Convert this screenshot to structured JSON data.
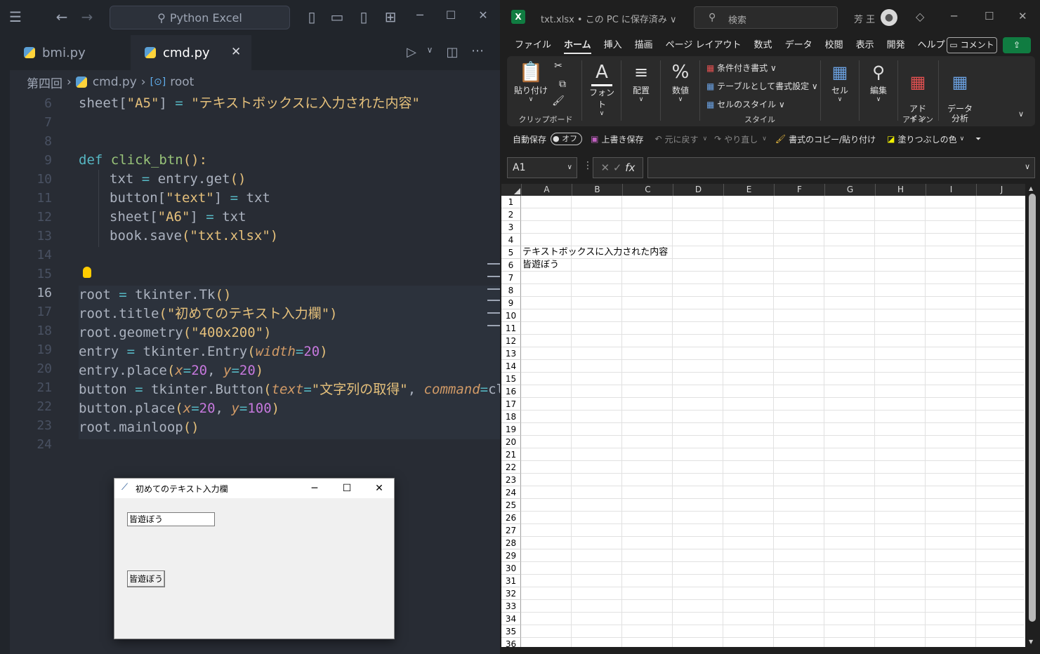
{
  "vscode": {
    "search_text": "Python Excel",
    "tabs": [
      {
        "label": "bmi.py",
        "active": false
      },
      {
        "label": "cmd.py",
        "active": true
      }
    ],
    "close_glyph": "✕",
    "breadcrumb": {
      "folder": "第四回",
      "file": "cmd.py",
      "symbol": "root"
    },
    "line_numbers": [
      "6",
      "7",
      "8",
      "9",
      "10",
      "11",
      "12",
      "13",
      "14",
      "15",
      "16",
      "17",
      "18",
      "19",
      "20",
      "21",
      "22",
      "23",
      "24"
    ],
    "active_line": "16",
    "code": {
      "l6": {
        "a": "sheet[",
        "b": "\"A5\"",
        "c": "] ",
        "d": "=",
        "e": " ",
        "f": "\"テキストボックスに入力された内容\""
      },
      "l9": {
        "a": "def",
        "b": " ",
        "c": "click_btn",
        "d": "():"
      },
      "l10": {
        "a": "txt ",
        "b": "=",
        "c": " entry.get",
        "d": "()"
      },
      "l11": {
        "a": "button[",
        "b": "\"text\"",
        "c": "] ",
        "d": "=",
        "e": " txt"
      },
      "l12": {
        "a": "sheet[",
        "b": "\"A6\"",
        "c": "] ",
        "d": "=",
        "e": " txt"
      },
      "l13": {
        "a": "book.save",
        "b": "(",
        "c": "\"txt.xlsx\"",
        "d": ")"
      },
      "l16": {
        "a": "root ",
        "b": "=",
        "c": " tkinter.Tk",
        "d": "()"
      },
      "l17": {
        "a": "root.title",
        "b": "(",
        "c": "\"初めてのテキスト入力欄\"",
        "d": ")"
      },
      "l18": {
        "a": "root.geometry",
        "b": "(",
        "c": "\"400x200\"",
        "d": ")"
      },
      "l19": {
        "a": "entry ",
        "b": "=",
        "c": " tkinter.Entry",
        "d": "(",
        "e": "width",
        "f": "=",
        "g": "20",
        "h": ")"
      },
      "l20": {
        "a": "entry.place",
        "b": "(",
        "c": "x",
        "d": "=",
        "e": "20",
        "f": ", ",
        "g": "y",
        "h": "=",
        "i": "20",
        "j": ")"
      },
      "l21": {
        "a": "button ",
        "b": "=",
        "c": " tkinter.Button",
        "d": "(",
        "e": "text",
        "f": "=",
        "g": "\"文字列の取得\"",
        "h": ", ",
        "i": "command",
        "j": "=",
        "k": "cl:"
      },
      "l22": {
        "a": "button.place",
        "b": "(",
        "c": "x",
        "d": "=",
        "e": "20",
        "f": ", ",
        "g": "y",
        "h": "=",
        "i": "100",
        "j": ")"
      },
      "l23": {
        "a": "root.mainloop",
        "b": "()"
      }
    }
  },
  "tk_window": {
    "title": "初めてのテキスト入力欄",
    "entry_value": "皆遊ぼう",
    "button_label": "皆遊ぼう"
  },
  "excel": {
    "title": "txt.xlsx • この PC に保存済み ∨",
    "search_placeholder": "検索",
    "user_name": "芳 王",
    "menu": [
      "ファイル",
      "ホーム",
      "挿入",
      "描画",
      "ページ レイアウト",
      "数式",
      "データ",
      "校閲",
      "表示",
      "開発",
      "ヘルプ"
    ],
    "active_menu": "ホーム",
    "comment_button": "コメント",
    "ribbon": {
      "paste": "貼り付け",
      "clipboard": "クリップボード",
      "font": "フォント",
      "align": "配置",
      "number": "数値",
      "cond_format": "条件付き書式 ∨",
      "table_format": "テーブルとして書式設定 ∨",
      "cell_style": "セルのスタイル ∨",
      "style": "スタイル",
      "cells": "セル",
      "edit": "編集",
      "addin": "アド\nイン",
      "addin_group": "アドイン",
      "analysis": "データ\n分析"
    },
    "qat": {
      "autosave": "自動保存",
      "toggle": "オフ",
      "save": "上書き保存",
      "undo": "元に戻す",
      "redo": "やり直し",
      "format_painter": "書式のコピー/貼り付け",
      "fill_color": "塗りつぶしの色"
    },
    "name_box": "A1",
    "columns": [
      "A",
      "B",
      "C",
      "D",
      "E",
      "F",
      "G",
      "H",
      "I",
      "J"
    ],
    "rows": [
      "1",
      "2",
      "3",
      "4",
      "5",
      "6",
      "7",
      "8",
      "9",
      "10",
      "11",
      "12",
      "13",
      "14",
      "15",
      "16",
      "17",
      "18",
      "19",
      "20",
      "21",
      "22",
      "23",
      "24",
      "25",
      "26",
      "27",
      "28",
      "29",
      "30",
      "31",
      "32",
      "33",
      "34",
      "35",
      "36"
    ],
    "cells": {
      "A5": "テキストボックスに入力された内容",
      "A6": "皆遊ぼう"
    },
    "colors": {
      "accent": "#107c41",
      "bg": "#1f1f1f"
    }
  }
}
